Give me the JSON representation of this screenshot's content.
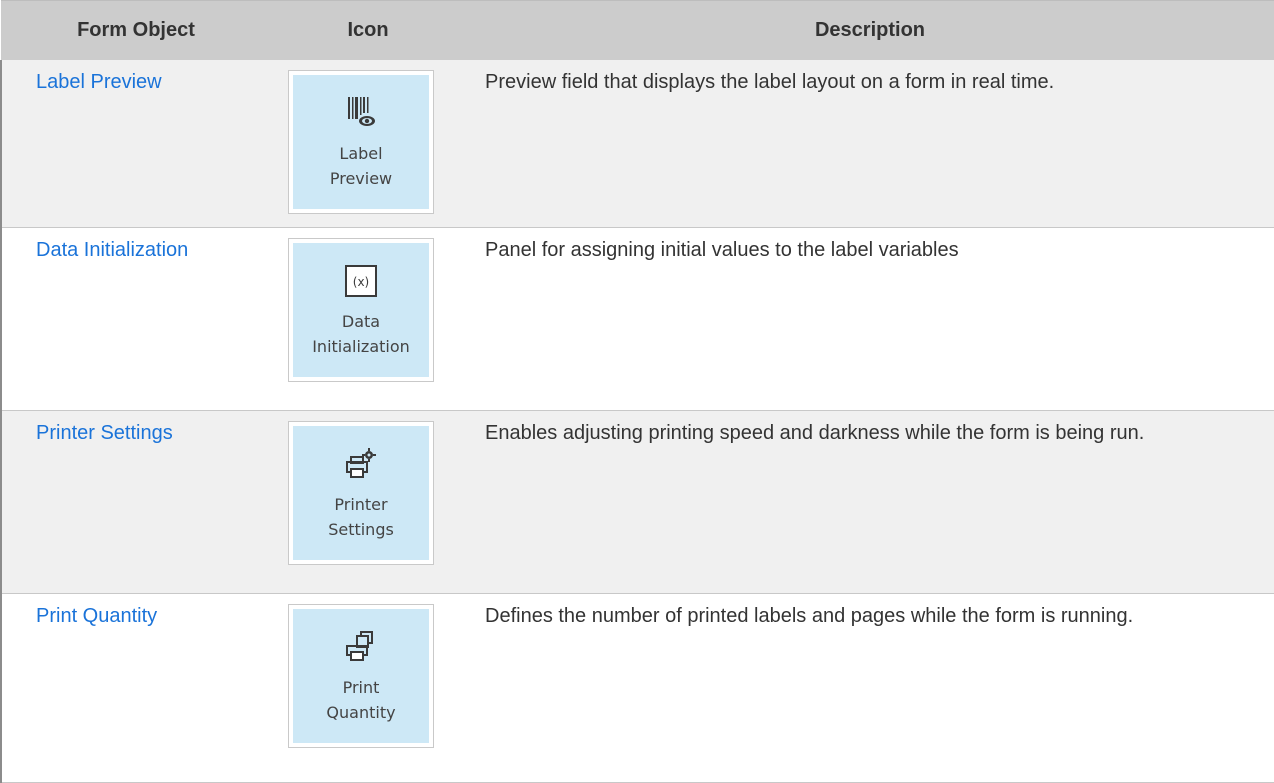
{
  "table": {
    "headers": {
      "form_object": "Form Object",
      "icon": "Icon",
      "description": "Description"
    },
    "rows": [
      {
        "name": "Label Preview",
        "icon_name": "label-preview-icon",
        "icon_label": "Label\nPreview",
        "description": "Preview field that displays the label layout on a form in real time."
      },
      {
        "name": "Data Initialization",
        "icon_name": "data-initialization-icon",
        "icon_label": "Data\nInitialization",
        "description": "Panel for assigning initial values to the label variables"
      },
      {
        "name": "Printer Settings",
        "icon_name": "printer-settings-icon",
        "icon_label": "Printer\nSettings",
        "description": "Enables adjusting printing speed and darkness while the form is being run."
      },
      {
        "name": "Print Quantity",
        "icon_name": "print-quantity-icon",
        "icon_label": "Print\nQuantity",
        "description": "Defines the number of printed labels and pages while the form is running."
      }
    ]
  },
  "colors": {
    "header_bg": "#cccccc",
    "row_alt_bg": "#f0f0f0",
    "link": "#1a73d9",
    "icon_bg": "#cde8f6"
  }
}
